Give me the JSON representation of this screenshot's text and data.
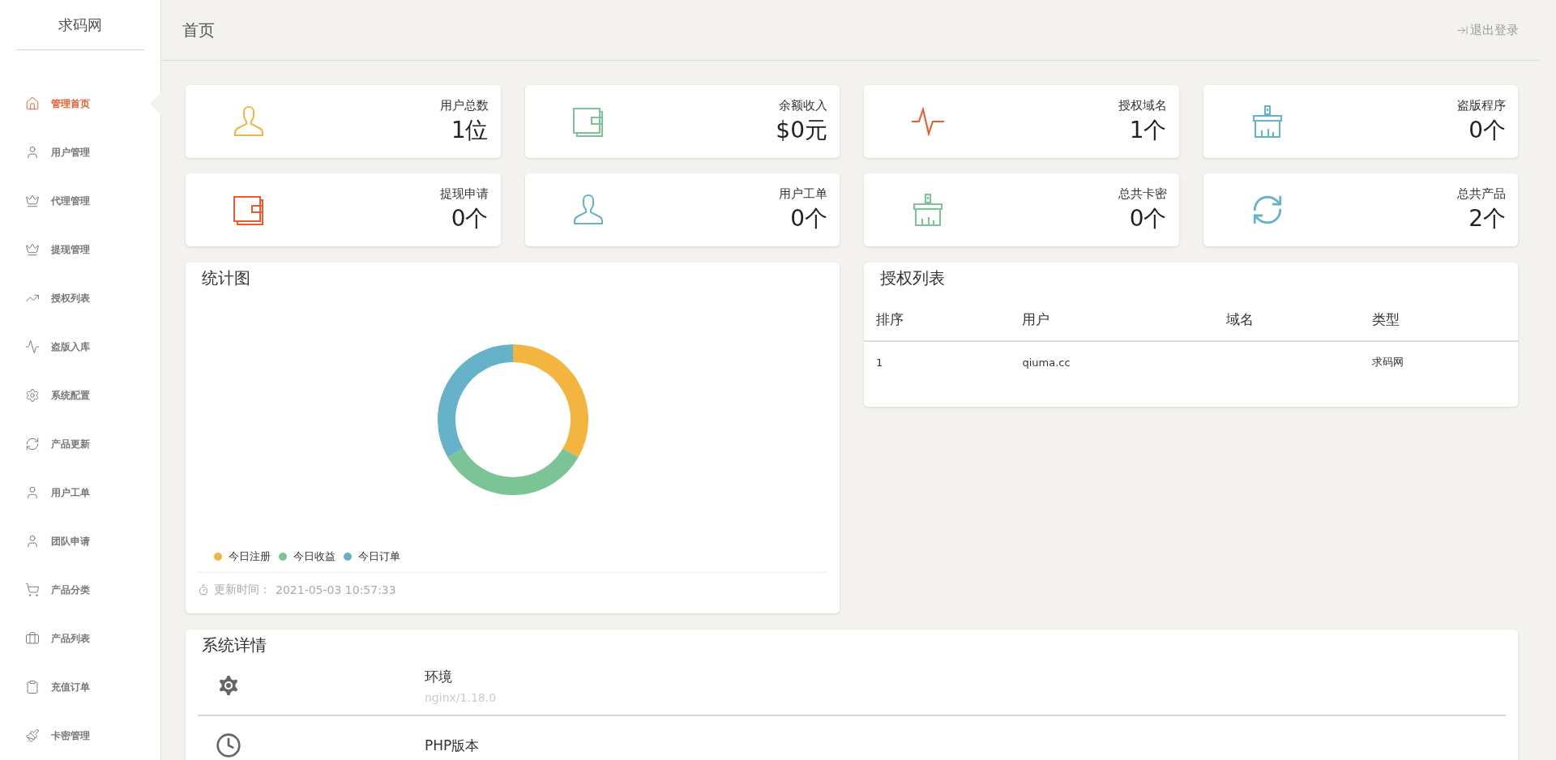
{
  "sidebar": {
    "logo": "求码网",
    "items": [
      {
        "label": "管理首页",
        "selected": true
      },
      {
        "label": "用户管理",
        "selected": false
      },
      {
        "label": "代理管理",
        "selected": false
      },
      {
        "label": "提现管理",
        "selected": false
      },
      {
        "label": "授权列表",
        "selected": false
      },
      {
        "label": "盗版入库",
        "selected": false
      },
      {
        "label": "系统配置",
        "selected": false
      },
      {
        "label": "产品更新",
        "selected": false
      },
      {
        "label": "用户工单",
        "selected": false
      },
      {
        "label": "团队申请",
        "selected": false
      },
      {
        "label": "产品分类",
        "selected": false
      },
      {
        "label": "产品列表",
        "selected": false
      },
      {
        "label": "充值订单",
        "selected": false
      },
      {
        "label": "卡密管理",
        "selected": false
      }
    ]
  },
  "header": {
    "title": "首页",
    "logout": "退出登录"
  },
  "stats": [
    {
      "label": "用户总数",
      "value": "1位",
      "color": "#f3b53f",
      "kind": "user"
    },
    {
      "label": "余额收入",
      "value": "$0元",
      "color": "#7bc496",
      "kind": "wallet"
    },
    {
      "label": "授权域名",
      "value": "1个",
      "color": "#f0592a",
      "kind": "pulse"
    },
    {
      "label": "盗版程序",
      "value": "0个",
      "color": "#66b2c9",
      "kind": "brush"
    },
    {
      "label": "提现申请",
      "value": "0个",
      "color": "#f0592a",
      "kind": "wallet"
    },
    {
      "label": "用户工单",
      "value": "0个",
      "color": "#66b2c9",
      "kind": "user"
    },
    {
      "label": "总共卡密",
      "value": "0个",
      "color": "#7bc496",
      "kind": "brush"
    },
    {
      "label": "总共产品",
      "value": "2个",
      "color": "#66b2c9",
      "kind": "refresh"
    }
  ],
  "chart": {
    "title": "统计图",
    "legend": [
      {
        "label": "今日注册",
        "color": "#f3b53f"
      },
      {
        "label": "今日收益",
        "color": "#7bc496"
      },
      {
        "label": "今日订单",
        "color": "#66b2c9"
      }
    ],
    "updated_label": "更新时间：",
    "updated_time": "2021-05-03 10:57:33"
  },
  "auth_table": {
    "title": "授权列表",
    "columns": [
      "排序",
      "用户",
      "域名",
      "类型"
    ],
    "rows": [
      [
        "1",
        "qiuma.cc",
        "",
        "求码网"
      ]
    ]
  },
  "system": {
    "title": "系统详情",
    "rows": [
      {
        "label": "环境",
        "value": "nginx/1.18.0"
      },
      {
        "label": "PHP版本"
      }
    ]
  }
}
